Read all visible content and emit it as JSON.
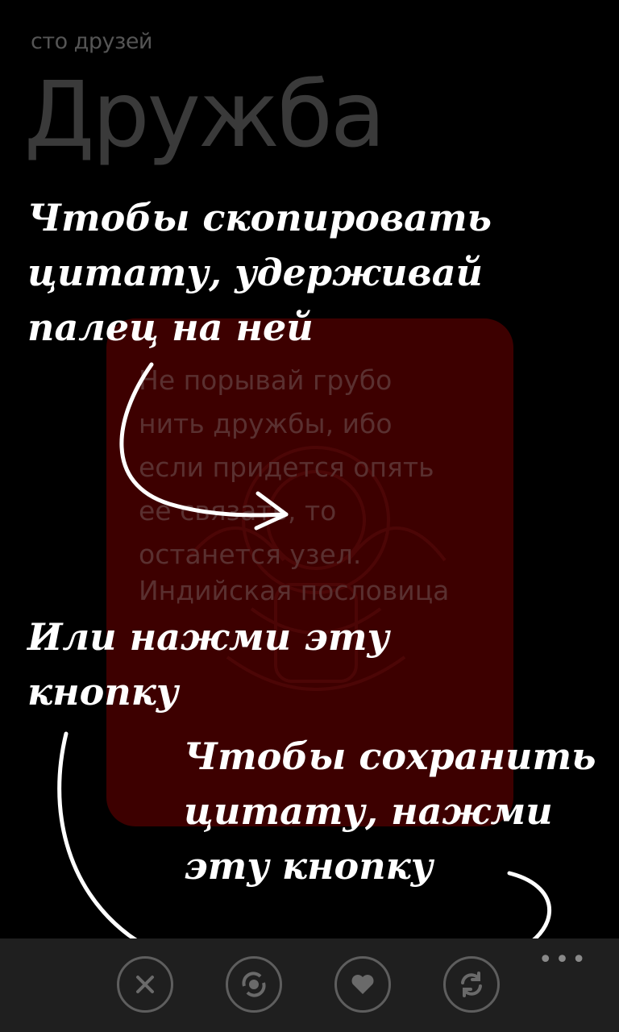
{
  "header": {
    "subtitle": "сто друзей",
    "title": "Дружба"
  },
  "quote": {
    "text": "Не порывай грубо\nнить дружбы, ибо\nесли придется опять\nее связать, то\nостанется узел.",
    "author": "Индийская пословица"
  },
  "hints": {
    "copy": "Чтобы скопировать\nцитату, удерживай\nпалец на ней",
    "button": "Или нажми эту\nкнопку",
    "save": "Чтобы сохранить\nцитату, нажми\nэту кнопку"
  },
  "app_bar": {
    "buttons": [
      {
        "icon": "close-icon"
      },
      {
        "icon": "copy-icon"
      },
      {
        "icon": "favorite-icon"
      },
      {
        "icon": "refresh-icon"
      }
    ],
    "more_label": "•••"
  },
  "colors": {
    "card": "#3d0000",
    "app_bar": "#1f1f1f",
    "title": "#3a3a3a"
  }
}
